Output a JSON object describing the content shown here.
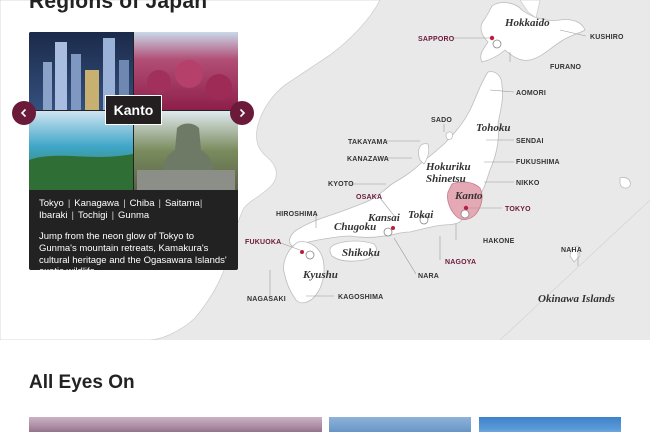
{
  "page": {
    "section_title": "Regions of Japan",
    "all_eyes_title": "All Eyes On"
  },
  "card": {
    "region": "Kanto",
    "prefectures": [
      "Tokyo",
      "Kanagawa",
      "Chiba",
      "Saitama",
      "Ibaraki",
      "Tochigi",
      "Gunma"
    ],
    "description": "Jump from the neon glow of Tokyo to Gunma's mountain retreats, Kamakura's cultural heritage and the Ogasawara Islands' exotic wildlife."
  },
  "map": {
    "regions": {
      "hokkaido": "Hokkaido",
      "tohoku": "Tohoku",
      "hokuriku": "Hokuriku",
      "shinetsu": "Shinetsu",
      "kanto": "Kanto",
      "tokai": "Tokai",
      "kansai": "Kansai",
      "chugoku": "Chugoku",
      "shikoku": "Shikoku",
      "kyushu": "Kyushu",
      "okinawa": "Okinawa Islands"
    },
    "cities": {
      "sapporo": "SAPPORO",
      "kushiro": "KUSHIRO",
      "furano": "FURANO",
      "aomori": "AOMORI",
      "sado": "SADO",
      "takayama": "TAKAYAMA",
      "sendai": "SENDAI",
      "kanazawa": "KANAZAWA",
      "fukushima": "FUKUSHIMA",
      "nikko": "NIKKO",
      "kyoto": "KYOTO",
      "osaka": "OSAKA",
      "tokyo": "TOKYO",
      "hiroshima": "HIROSHIMA",
      "fukuoka": "FUKUOKA",
      "hakone": "HAKONE",
      "nagoya": "NAGOYA",
      "nara": "NARA",
      "naha": "NAHA",
      "nagasaki": "NAGASAKI",
      "kagoshima": "KAGOSHIMA"
    }
  },
  "colors": {
    "accent": "#6b1a3a",
    "highlight_region": "#e4a9b4",
    "city_red": "#6b1a3a",
    "land": "#ffffff",
    "sea": "#e9e9e9"
  },
  "icons": {
    "prev": "chevron-left-icon",
    "next": "chevron-right-icon"
  }
}
